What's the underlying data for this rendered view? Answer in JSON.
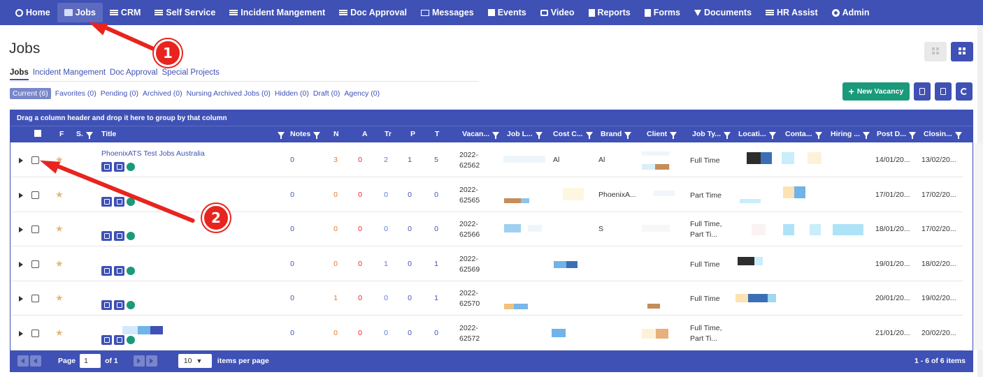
{
  "nav": [
    {
      "label": "Home",
      "icon": "home-icon"
    },
    {
      "label": "Jobs",
      "icon": "folder-icon",
      "active": true
    },
    {
      "label": "CRM",
      "icon": "bars-icon"
    },
    {
      "label": "Self Service",
      "icon": "bars-icon"
    },
    {
      "label": "Incident Mangement",
      "icon": "bars-icon"
    },
    {
      "label": "Doc Approval",
      "icon": "bars-icon"
    },
    {
      "label": "Messages",
      "icon": "envelope-icon"
    },
    {
      "label": "Events",
      "icon": "calendar-icon"
    },
    {
      "label": "Video",
      "icon": "monitor-icon"
    },
    {
      "label": "Reports",
      "icon": "doc-icon"
    },
    {
      "label": "Forms",
      "icon": "doc-icon"
    },
    {
      "label": "Documents",
      "icon": "filter-icon"
    },
    {
      "label": "HR Assist",
      "icon": "bars-icon"
    },
    {
      "label": "Admin",
      "icon": "gear-icon"
    }
  ],
  "page": {
    "title": "Jobs"
  },
  "annotations": [
    "1",
    "2"
  ],
  "tabs": [
    "Jobs",
    "Incident Mangement",
    "Doc Approval",
    "Special Projects"
  ],
  "filters": [
    "Current (6)",
    "Favorites (0)",
    "Pending (0)",
    "Archived (0)",
    "Nursing Archived Jobs (0)",
    "Hidden (0)",
    "Draft (0)",
    "Agency (0)"
  ],
  "actions": {
    "new_vacancy": "New Vacancy"
  },
  "grid": {
    "group_hint": "Drag a column header and drop it here to group by that column",
    "columns": [
      "F",
      "S.",
      "Title",
      "Notes",
      "N",
      "A",
      "Tr",
      "P",
      "T",
      "Vacan...",
      "Job L...",
      "Cost C...",
      "Brand",
      "Client",
      "Job Ty...",
      "Locati...",
      "Conta...",
      "Hiring ...",
      "Post D...",
      "Closin..."
    ],
    "rows": [
      {
        "title": "PhoenixATS Test Jobs Australia",
        "notes": "0",
        "n": "3",
        "a": "0",
        "tr": "2",
        "p": "1",
        "t": "5",
        "vac1": "2022-",
        "vac2": "62562",
        "cost": "Al",
        "brand": "Al",
        "jobtype1": "Full Time",
        "jobtype2": "",
        "post": "14/01/20...",
        "close": "13/02/20..."
      },
      {
        "title": "",
        "notes": "0",
        "n": "0",
        "a": "0",
        "tr": "0",
        "p": "0",
        "t": "0",
        "vac1": "2022-",
        "vac2": "62565",
        "cost": "",
        "brand": "PhoenixA...",
        "jobtype1": "Part Time",
        "jobtype2": "",
        "post": "17/01/20...",
        "close": "17/02/20..."
      },
      {
        "title": "",
        "notes": "0",
        "n": "0",
        "a": "0",
        "tr": "0",
        "p": "0",
        "t": "0",
        "vac1": "2022-",
        "vac2": "62566",
        "cost": "",
        "brand": "S",
        "jobtype1": "Full Time,",
        "jobtype2": "Part Ti...",
        "post": "18/01/20...",
        "close": "17/02/20..."
      },
      {
        "title": "",
        "notes": "0",
        "n": "0",
        "a": "0",
        "tr": "1",
        "p": "0",
        "t": "1",
        "vac1": "2022-",
        "vac2": "62569",
        "cost": "",
        "brand": "",
        "jobtype1": "Full Time",
        "jobtype2": "",
        "post": "19/01/20...",
        "close": "18/02/20..."
      },
      {
        "title": "",
        "notes": "0",
        "n": "1",
        "a": "0",
        "tr": "0",
        "p": "0",
        "t": "1",
        "vac1": "2022-",
        "vac2": "62570",
        "cost": "",
        "brand": "",
        "jobtype1": "Full Time",
        "jobtype2": "",
        "post": "20/01/20...",
        "close": "19/02/20..."
      },
      {
        "title": "",
        "notes": "0",
        "n": "0",
        "a": "0",
        "tr": "0",
        "p": "0",
        "t": "0",
        "vac1": "2022-",
        "vac2": "62572",
        "cost": "",
        "brand": "",
        "jobtype1": "Full Time,",
        "jobtype2": "Part Ti...",
        "post": "21/01/20...",
        "close": "20/02/20..."
      }
    ]
  },
  "pager": {
    "page_label": "Page",
    "page_value": "1",
    "of_label": "of 1",
    "per_page": "10",
    "per_page_label": "items per page",
    "summary": "1 - 6 of 6 items"
  }
}
